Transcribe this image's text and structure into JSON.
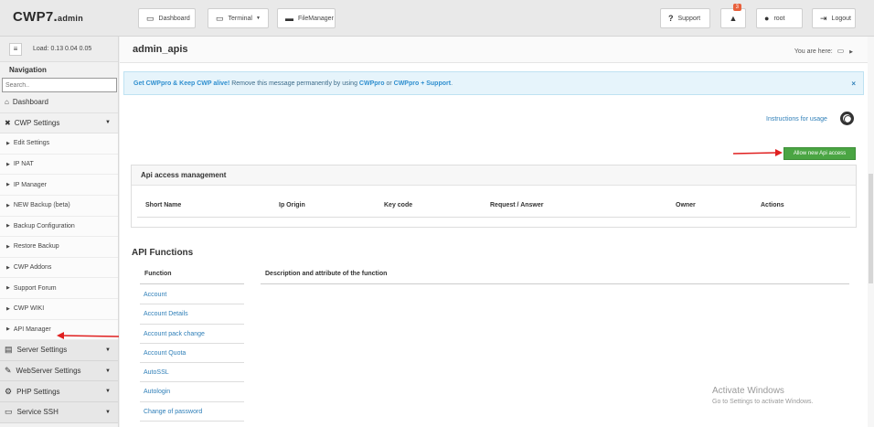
{
  "header": {
    "logo_main": "CWP7.",
    "logo_sub": "admin",
    "dashboard": "Dashboard",
    "terminal": "Terminal",
    "filemanager": "FileManager",
    "support": "Support",
    "notif_count": "3",
    "user": "root",
    "logout": "Logout"
  },
  "sidebar": {
    "load_label": "Load: 0.13  0.04  0.05",
    "nav_title": "Navigation",
    "search_placeholder": "Search..",
    "dashboard": "Dashboard",
    "cwp_settings": "CWP Settings",
    "sub_items": [
      "Edit Settings",
      "IP NAT",
      "IP Manager",
      "NEW Backup (beta)",
      "Backup Configuration",
      "Restore Backup",
      "CWP Addons",
      "Support Forum",
      "CWP WIKI",
      "API Manager"
    ],
    "groups": [
      "Server Settings",
      "WebServer Settings",
      "PHP Settings",
      "Service SSH"
    ]
  },
  "main": {
    "page_title": "admin_apis",
    "you_are_here": "You are here:",
    "alert_bold": "Get CWPpro & Keep CWP alive!",
    "alert_text": " Remove this message permanently by using ",
    "alert_cwppro": "CWPpro",
    "alert_or": " or ",
    "alert_cwppro_support": "CWPpro + Support",
    "alert_end": ".",
    "alert_close": "×",
    "instructions": "Instructions for usage",
    "allow_button": "Allow new Api access",
    "api_panel_title": "Api access management",
    "columns": [
      "Short Name",
      "Ip Origin",
      "Key code",
      "Request / Answer",
      "Owner",
      "Actions"
    ],
    "api_functions_title": "API Functions",
    "fn_col_function": "Function",
    "fn_col_desc": "Description and attribute of the function",
    "functions": [
      "Account",
      "Account Details",
      "Account pack change",
      "Account Quota",
      "AutoSSL",
      "Autologin",
      "Change of password"
    ]
  },
  "watermark": {
    "line1": "Activate Windows",
    "line2": "Go to Settings to activate Windows."
  },
  "colors": {
    "accent": "#2f7fb8",
    "allow": "#4aa543",
    "arrow": "#e02020",
    "badge": "#e8603c"
  }
}
